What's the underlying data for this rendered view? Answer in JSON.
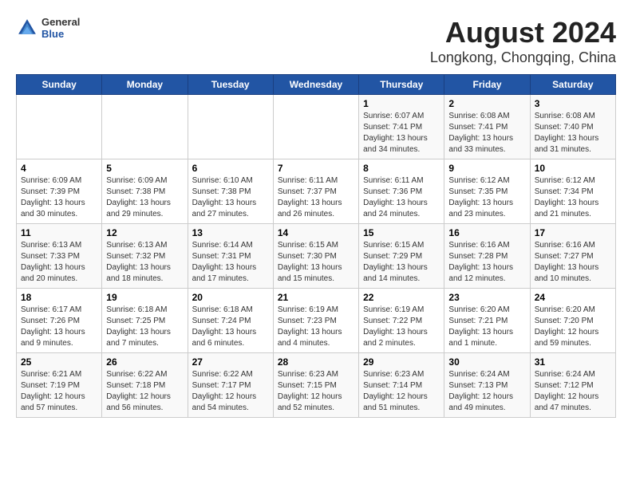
{
  "header": {
    "logo_general": "General",
    "logo_blue": "Blue",
    "title": "August 2024",
    "subtitle": "Longkong, Chongqing, China"
  },
  "weekdays": [
    "Sunday",
    "Monday",
    "Tuesday",
    "Wednesday",
    "Thursday",
    "Friday",
    "Saturday"
  ],
  "weeks": [
    [
      {
        "day": "",
        "info": ""
      },
      {
        "day": "",
        "info": ""
      },
      {
        "day": "",
        "info": ""
      },
      {
        "day": "",
        "info": ""
      },
      {
        "day": "1",
        "info": "Sunrise: 6:07 AM\nSunset: 7:41 PM\nDaylight: 13 hours and 34 minutes."
      },
      {
        "day": "2",
        "info": "Sunrise: 6:08 AM\nSunset: 7:41 PM\nDaylight: 13 hours and 33 minutes."
      },
      {
        "day": "3",
        "info": "Sunrise: 6:08 AM\nSunset: 7:40 PM\nDaylight: 13 hours and 31 minutes."
      }
    ],
    [
      {
        "day": "4",
        "info": "Sunrise: 6:09 AM\nSunset: 7:39 PM\nDaylight: 13 hours and 30 minutes."
      },
      {
        "day": "5",
        "info": "Sunrise: 6:09 AM\nSunset: 7:38 PM\nDaylight: 13 hours and 29 minutes."
      },
      {
        "day": "6",
        "info": "Sunrise: 6:10 AM\nSunset: 7:38 PM\nDaylight: 13 hours and 27 minutes."
      },
      {
        "day": "7",
        "info": "Sunrise: 6:11 AM\nSunset: 7:37 PM\nDaylight: 13 hours and 26 minutes."
      },
      {
        "day": "8",
        "info": "Sunrise: 6:11 AM\nSunset: 7:36 PM\nDaylight: 13 hours and 24 minutes."
      },
      {
        "day": "9",
        "info": "Sunrise: 6:12 AM\nSunset: 7:35 PM\nDaylight: 13 hours and 23 minutes."
      },
      {
        "day": "10",
        "info": "Sunrise: 6:12 AM\nSunset: 7:34 PM\nDaylight: 13 hours and 21 minutes."
      }
    ],
    [
      {
        "day": "11",
        "info": "Sunrise: 6:13 AM\nSunset: 7:33 PM\nDaylight: 13 hours and 20 minutes."
      },
      {
        "day": "12",
        "info": "Sunrise: 6:13 AM\nSunset: 7:32 PM\nDaylight: 13 hours and 18 minutes."
      },
      {
        "day": "13",
        "info": "Sunrise: 6:14 AM\nSunset: 7:31 PM\nDaylight: 13 hours and 17 minutes."
      },
      {
        "day": "14",
        "info": "Sunrise: 6:15 AM\nSunset: 7:30 PM\nDaylight: 13 hours and 15 minutes."
      },
      {
        "day": "15",
        "info": "Sunrise: 6:15 AM\nSunset: 7:29 PM\nDaylight: 13 hours and 14 minutes."
      },
      {
        "day": "16",
        "info": "Sunrise: 6:16 AM\nSunset: 7:28 PM\nDaylight: 13 hours and 12 minutes."
      },
      {
        "day": "17",
        "info": "Sunrise: 6:16 AM\nSunset: 7:27 PM\nDaylight: 13 hours and 10 minutes."
      }
    ],
    [
      {
        "day": "18",
        "info": "Sunrise: 6:17 AM\nSunset: 7:26 PM\nDaylight: 13 hours and 9 minutes."
      },
      {
        "day": "19",
        "info": "Sunrise: 6:18 AM\nSunset: 7:25 PM\nDaylight: 13 hours and 7 minutes."
      },
      {
        "day": "20",
        "info": "Sunrise: 6:18 AM\nSunset: 7:24 PM\nDaylight: 13 hours and 6 minutes."
      },
      {
        "day": "21",
        "info": "Sunrise: 6:19 AM\nSunset: 7:23 PM\nDaylight: 13 hours and 4 minutes."
      },
      {
        "day": "22",
        "info": "Sunrise: 6:19 AM\nSunset: 7:22 PM\nDaylight: 13 hours and 2 minutes."
      },
      {
        "day": "23",
        "info": "Sunrise: 6:20 AM\nSunset: 7:21 PM\nDaylight: 13 hours and 1 minute."
      },
      {
        "day": "24",
        "info": "Sunrise: 6:20 AM\nSunset: 7:20 PM\nDaylight: 12 hours and 59 minutes."
      }
    ],
    [
      {
        "day": "25",
        "info": "Sunrise: 6:21 AM\nSunset: 7:19 PM\nDaylight: 12 hours and 57 minutes."
      },
      {
        "day": "26",
        "info": "Sunrise: 6:22 AM\nSunset: 7:18 PM\nDaylight: 12 hours and 56 minutes."
      },
      {
        "day": "27",
        "info": "Sunrise: 6:22 AM\nSunset: 7:17 PM\nDaylight: 12 hours and 54 minutes."
      },
      {
        "day": "28",
        "info": "Sunrise: 6:23 AM\nSunset: 7:15 PM\nDaylight: 12 hours and 52 minutes."
      },
      {
        "day": "29",
        "info": "Sunrise: 6:23 AM\nSunset: 7:14 PM\nDaylight: 12 hours and 51 minutes."
      },
      {
        "day": "30",
        "info": "Sunrise: 6:24 AM\nSunset: 7:13 PM\nDaylight: 12 hours and 49 minutes."
      },
      {
        "day": "31",
        "info": "Sunrise: 6:24 AM\nSunset: 7:12 PM\nDaylight: 12 hours and 47 minutes."
      }
    ]
  ]
}
